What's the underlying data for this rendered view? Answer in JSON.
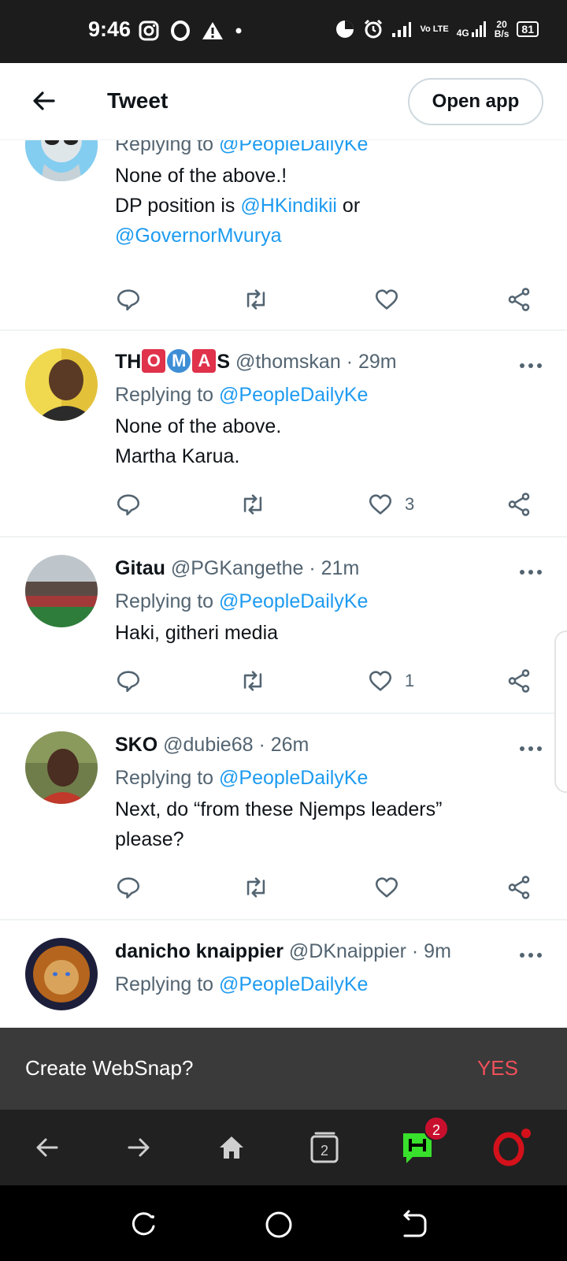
{
  "status_bar": {
    "time": "9:46",
    "network_speed_top": "20",
    "network_speed_bottom": "B/s",
    "volte": "Vo LTE",
    "gen": "4G",
    "battery": "81"
  },
  "header": {
    "title": "Tweet",
    "open_app_label": "Open app"
  },
  "tweets": [
    {
      "name": "",
      "handle": "",
      "time": "",
      "replying_prefix": "Replying to ",
      "replying_to": "@PeopleDailyKe",
      "text_line1": "None of the above.!",
      "text_line2_prefix": "DP position is ",
      "text_line2_mention": "@HKindikii",
      "text_line2_suffix": " or",
      "text_line3_mention": "@GovernorMvurya",
      "likes": ""
    },
    {
      "name_parts": [
        "TH",
        "O",
        "M",
        "A",
        "S"
      ],
      "handle": "@thomskan",
      "time": "· 29m",
      "replying_prefix": "Replying to ",
      "replying_to": "@PeopleDailyKe",
      "text_line1": "None of the above.",
      "text_line2": "Martha Karua.",
      "likes": "3"
    },
    {
      "name": "Gitau",
      "handle": "@PGKangethe",
      "time": "· 21m",
      "replying_prefix": "Replying to ",
      "replying_to": "@PeopleDailyKe",
      "text_line1": "Haki, githeri media",
      "likes": "1"
    },
    {
      "name": "SKO",
      "handle": "@dubie68",
      "time": "· 26m",
      "replying_prefix": "Replying to ",
      "replying_to": "@PeopleDailyKe",
      "text_line1": "Next, do “from these Njemps leaders”",
      "text_line2": "please?",
      "likes": ""
    },
    {
      "name": "danicho knaippier",
      "handle": "@DKnaippier",
      "time": "· 9m",
      "replying_prefix": "Replying to ",
      "replying_to": "@PeopleDailyKe",
      "likes": ""
    }
  ],
  "websnap": {
    "label": "Create WebSnap?",
    "yes": "YES"
  },
  "browser_nav": {
    "tabs_count": "2",
    "notification_count": "2"
  },
  "icons": [
    "back-arrow-icon",
    "reply-icon",
    "retweet-icon",
    "like-icon",
    "share-icon",
    "more-icon",
    "home-icon",
    "tabs-icon",
    "hype-chat-icon",
    "opera-logo-icon"
  ],
  "colors": {
    "accent": "#1d9bf0",
    "muted": "#536471",
    "yes": "#f0505a",
    "chat_green": "#38e12b"
  }
}
